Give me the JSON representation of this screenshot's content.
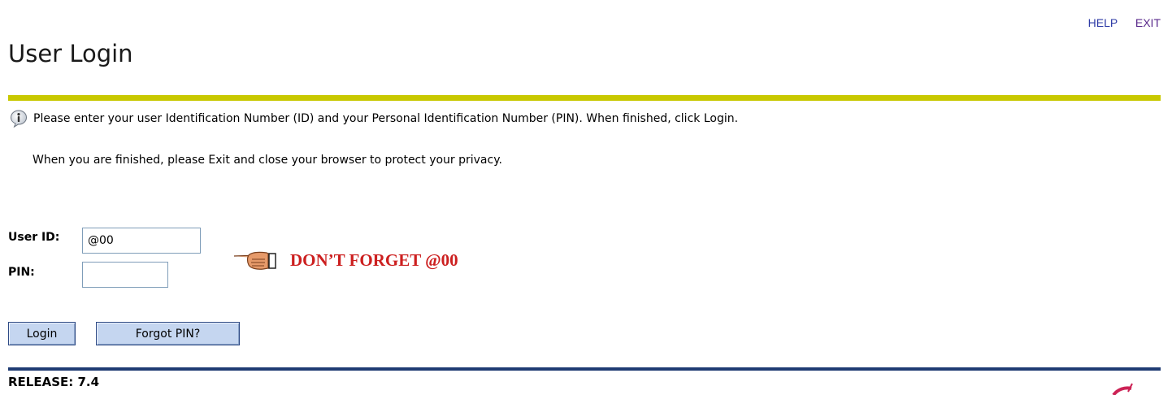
{
  "nav": {
    "help_label": "HELP",
    "exit_label": "EXIT"
  },
  "page": {
    "title": "User Login",
    "info_message": "Please enter your user Identification Number (ID) and your Personal Identification Number (PIN). When finished, click Login.",
    "privacy_message": "When you are finished, please Exit and close your browser to protect your privacy."
  },
  "form": {
    "userid_label": "User ID:",
    "userid_value": "@00",
    "pin_label": "PIN:",
    "pin_value": "",
    "reminder": "DON’T FORGET @00",
    "login_button": "Login",
    "forgot_button": "Forgot PIN?"
  },
  "footer": {
    "release": "RELEASE: 7.4"
  },
  "icons": {
    "info": "info-icon",
    "pointer": "pointing-hand-icon",
    "logo": "logo-icon"
  },
  "colors": {
    "title_rule": "#c8c800",
    "footer_rule": "#1f3b73",
    "reminder_text": "#cc1f1f",
    "button_bg": "#c5d6f0",
    "link": "#2e3ba6"
  }
}
